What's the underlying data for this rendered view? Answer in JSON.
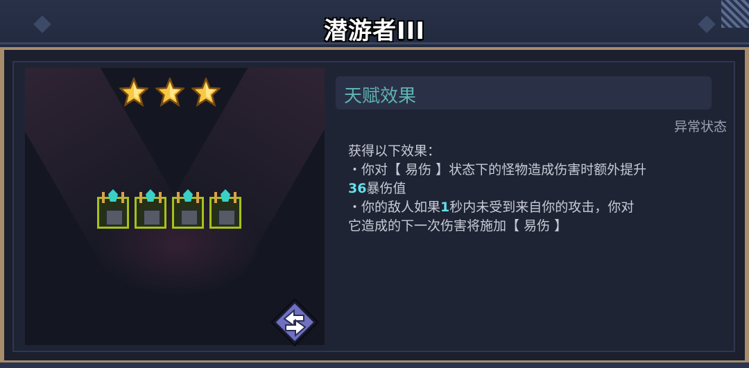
{
  "title": "潜游者III",
  "stars": {
    "count": 3,
    "icon": "star-icon",
    "color": "#f7c843"
  },
  "items": {
    "count": 4,
    "icon": "turret-icon",
    "border_color": "#a6c21a",
    "gem_color": "#39d0c8"
  },
  "swap_button": {
    "icon": "swap-arrows-icon",
    "color": "#8a8bd4"
  },
  "talent": {
    "header": "天赋效果",
    "category": "异常状态",
    "intro": "获得以下效果：",
    "effect1_prefix": "・你对【 易伤 】状态下的怪物造成伤害时额外提升",
    "effect1_value": "36",
    "effect1_suffix": "暴伤值",
    "effect2_prefix": "・你的敌人如果",
    "effect2_value": "1",
    "effect2_mid": "秒内未受到来自你的攻击，你对",
    "effect2_suffix": "它造成的下一次伤害将施加【 易伤 】"
  },
  "colors": {
    "accent_trim": "#a88d6a",
    "highlight": "#63e0ea",
    "header_text": "#5fb3b3"
  }
}
